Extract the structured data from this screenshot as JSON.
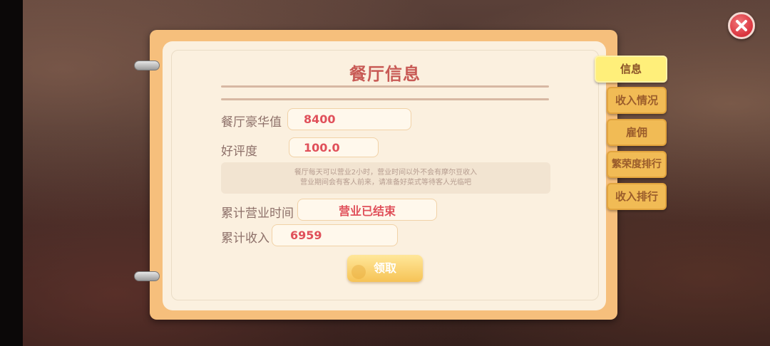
{
  "title": "餐厅信息",
  "fields": {
    "luxury": {
      "label": "餐厅豪华值",
      "value": "8400"
    },
    "rating": {
      "label": "好评度",
      "value": "100.0"
    },
    "business_time": {
      "label": "累计营业时间",
      "value": "营业已结束"
    },
    "income": {
      "label": "累计收入",
      "value": "6959"
    }
  },
  "notice": {
    "line1": "餐厅每天可以营业2小时，营业时间以外不会有摩尔豆收入",
    "line2": "营业期间会有客人前来，请准备好菜式等待客人光临吧"
  },
  "claim_button": "领取",
  "tabs": [
    "信息",
    "收入情况",
    "雇佣",
    "繁荣度排行",
    "收入排行"
  ],
  "active_tab_index": 0,
  "colors": {
    "accent": "#e0505a",
    "title": "#c85a55",
    "tab": "#f1bb55",
    "tab_active": "#ffef7a"
  }
}
